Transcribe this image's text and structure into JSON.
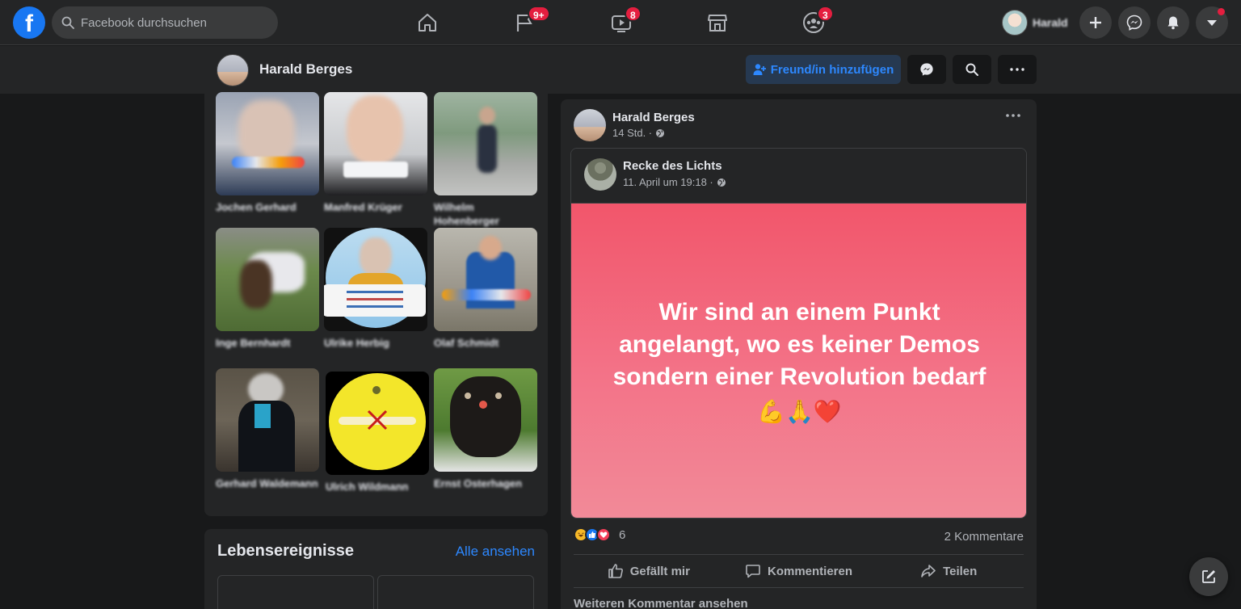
{
  "search": {
    "placeholder": "Facebook durchsuchen"
  },
  "nav": {
    "tabs": [
      {
        "name": "home",
        "badge": ""
      },
      {
        "name": "pages",
        "badge": "9+"
      },
      {
        "name": "watch",
        "badge": "8"
      },
      {
        "name": "marketplace",
        "badge": ""
      },
      {
        "name": "groups",
        "badge": "3"
      }
    ],
    "profile_chip_name": "Harald"
  },
  "profile": {
    "name": "Harald Berges",
    "add_friend_label": "Freund/in hinzufügen"
  },
  "friends": [
    {
      "name": "Jochen Gerhard"
    },
    {
      "name": "Manfred Krüger"
    },
    {
      "name": "Wilhelm Hohenberger"
    },
    {
      "name": "Inge Bernhardt"
    },
    {
      "name": "Ulrike Herbig"
    },
    {
      "name": "Olaf Schmidt"
    },
    {
      "name": "Gerhard Waldemann"
    },
    {
      "name": "Ulrich Wildmann"
    },
    {
      "name": "Ernst Osterhagen"
    }
  ],
  "life_events": {
    "title": "Lebensereignisse",
    "see_all": "Alle ansehen"
  },
  "post": {
    "author": "Harald Berges",
    "time": "14 Std. ·",
    "shared": {
      "author": "Recke des Lichts",
      "time": "11. April um 19:18 ·",
      "text": "Wir sind an einem Punkt angelangt, wo es keiner Demos sondern einer Revolution bedarf",
      "emoji": "💪🙏❤️"
    },
    "reaction_count": "6",
    "comments_count": "2 Kommentare",
    "like_label": "Gefällt mir",
    "comment_label": "Kommentieren",
    "share_label": "Teilen",
    "more_comments": "Weiteren Kommentar ansehen"
  },
  "colors": {
    "brand": "#1877f2",
    "badge": "#e41e3f",
    "link": "#2d88ff",
    "post_bg": "#f2566b"
  }
}
